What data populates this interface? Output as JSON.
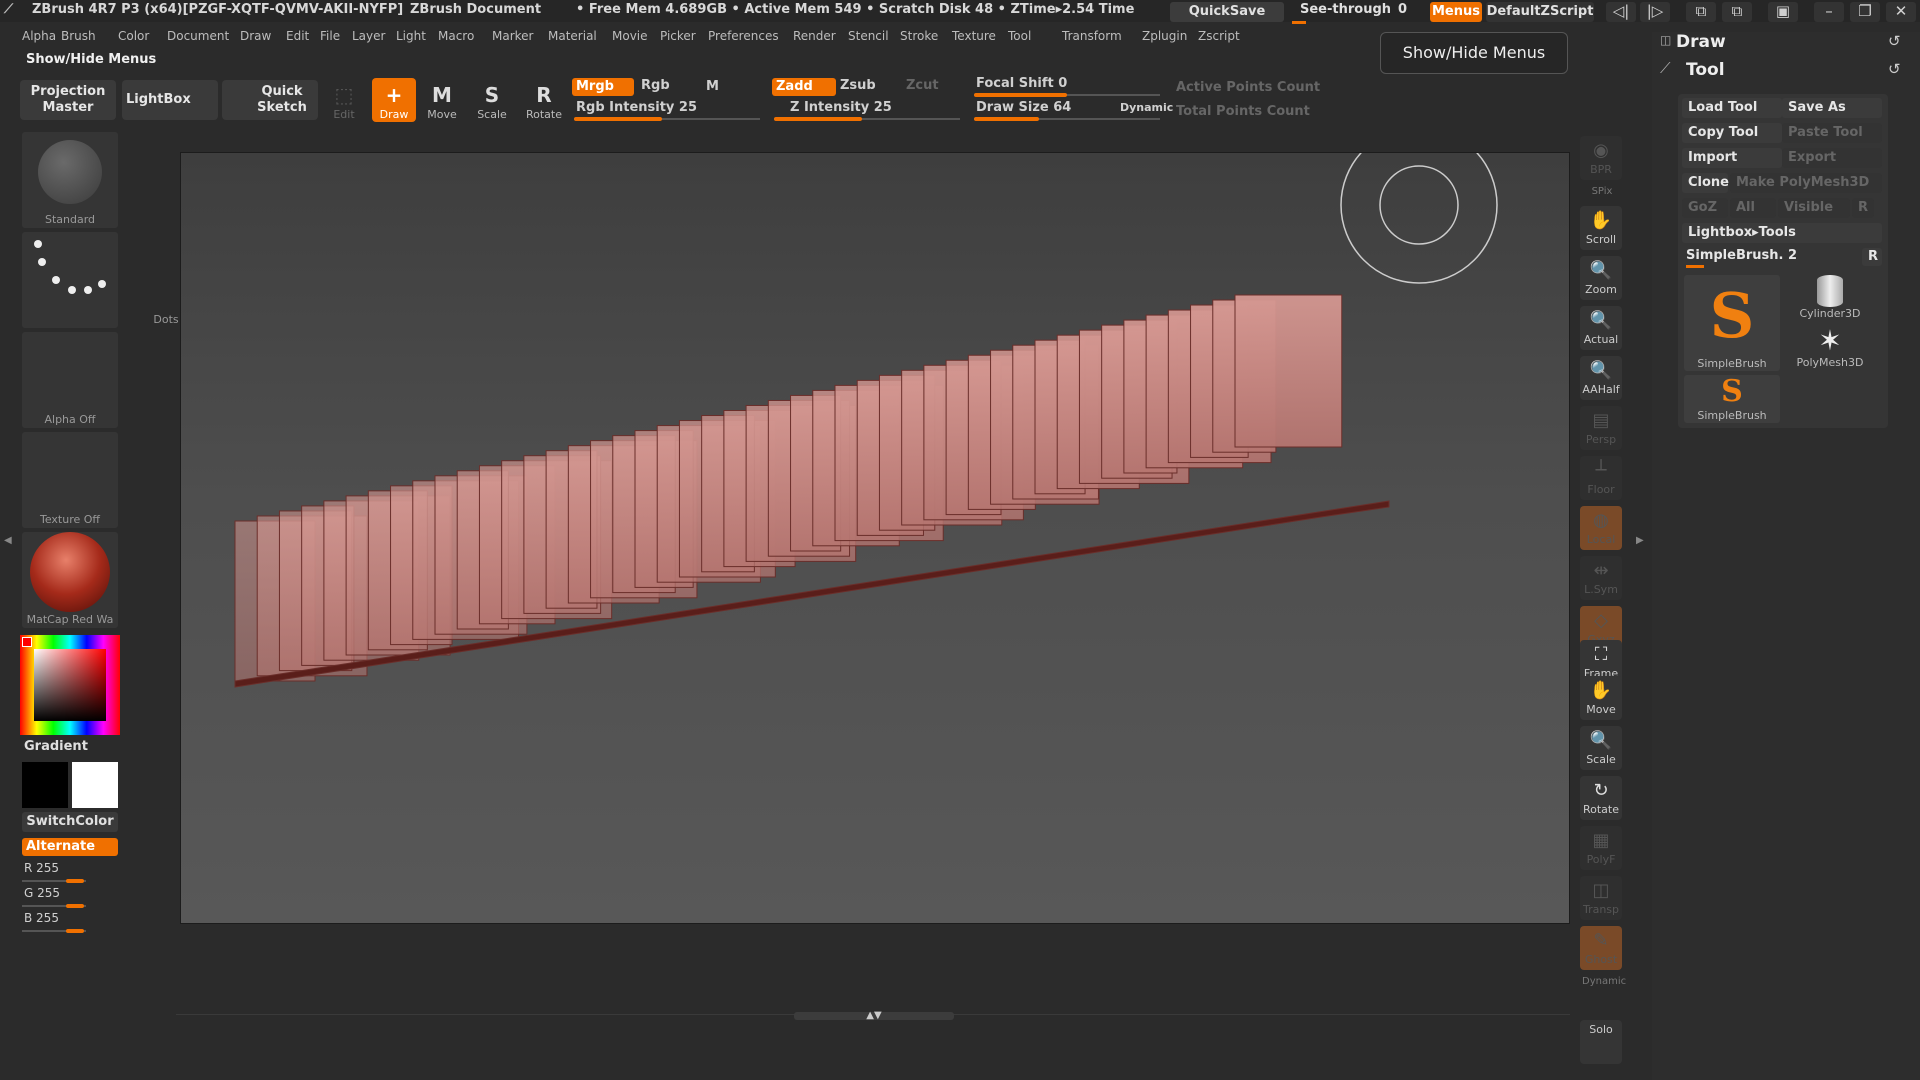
{
  "title": {
    "app": "ZBrush 4R7 P3 (x64)[PZGF-XQTF-QVMV-AKII-NYFP]",
    "doc": "ZBrush Document",
    "stats": "• Free Mem 4.689GB • Active Mem 549 • Scratch Disk 48 • ZTime▸2.54 Time",
    "quicksave": "QuickSave",
    "seethrough": "See-through",
    "seethrough_value": "0",
    "menus": "Menus",
    "script": "DefaultZScript"
  },
  "menu_items": [
    "Alpha",
    "Brush",
    "Color",
    "Document",
    "Draw",
    "Edit",
    "File",
    "Layer",
    "Light",
    "Macro",
    "Marker",
    "Material",
    "Movie",
    "Picker",
    "Preferences",
    "Render",
    "Stencil",
    "Stroke",
    "Texture",
    "Tool",
    "Transform",
    "Zplugin",
    "Zscript"
  ],
  "show_hide": "Show/Hide Menus",
  "tooltip": "Show/Hide Menus",
  "toolbar": {
    "projection_master": "Projection Master",
    "lightbox": "LightBox",
    "quick_sketch": "Quick Sketch",
    "edit": "Edit",
    "draw": "Draw",
    "move": "Move",
    "scale": "Scale",
    "rotate": "Rotate",
    "mrgb": "Mrgb",
    "rgb": "Rgb",
    "m": "M",
    "zadd": "Zadd",
    "zsub": "Zsub",
    "zcut": "Zcut",
    "rgb_intensity": "Rgb Intensity 25",
    "z_intensity": "Z Intensity 25",
    "focal_shift": "Focal Shift 0",
    "draw_size": "Draw Size 64",
    "dynamic": "Dynamic",
    "active_points": "Active Points Count",
    "total_points": "Total Points Count",
    "rgb_intensity_level": 0.25,
    "z_intensity_level": 0.25,
    "focal_shift_level": 0.5,
    "draw_size_level": 0.35
  },
  "left": {
    "brush": "Standard",
    "stroke": "Dots",
    "alpha": "Alpha Off",
    "texture": "Texture Off",
    "material": "MatCap Red Wa",
    "gradient": "Gradient",
    "switchcolor": "SwitchColor",
    "alternate": "Alternate",
    "r": "R 255",
    "g": "G 255",
    "b": "B 255"
  },
  "right_tools": [
    "BPR",
    "SPix",
    "Scroll",
    "Zoom",
    "Actual",
    "AAHalf",
    "Persp",
    "Floor",
    "Local",
    "L.Sym",
    "Gxyz",
    "Frame",
    "Move",
    "Scale",
    "Rotate",
    "PolyF",
    "Transp",
    "Ghost",
    "Dynamic",
    "Solo"
  ],
  "panel": {
    "draw": "Draw",
    "tool": "Tool",
    "load_tool": "Load Tool",
    "save_as": "Save As",
    "copy_tool": "Copy Tool",
    "paste_tool": "Paste Tool",
    "import": "Import",
    "export": "Export",
    "clone": "Clone",
    "make_polymesh": "Make PolyMesh3D",
    "goz": "GoZ",
    "all": "All",
    "visible": "Visible",
    "r": "R",
    "lightbox_tools": "Lightbox▸Tools",
    "current_tool": "SimpleBrush. 2",
    "thumb1": "SimpleBrush",
    "thumb2": "Cylinder3D",
    "thumb3": "PolyMesh3D",
    "thumb4": "SimpleBrush"
  },
  "colors": {
    "accent": "#f07000",
    "bg": "#2b2b2b",
    "mesh": "#c98a86"
  }
}
